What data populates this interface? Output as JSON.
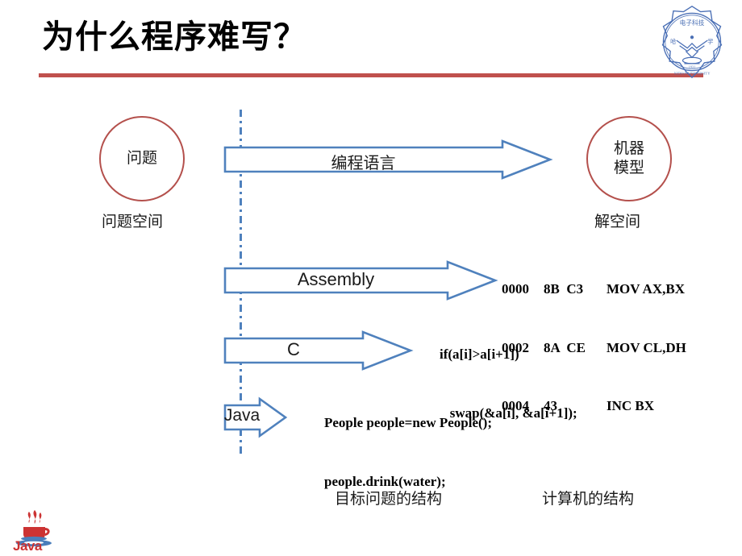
{
  "slide": {
    "title": "为什么程序难写？",
    "accent_color": "#C0504D",
    "arrow_color": "#4F81BD",
    "circle_color": "#B4504C"
  },
  "logo": {
    "name": "xidian-university-seal",
    "latin_text": "XIDIAN UNIVERSITY",
    "year": "1931"
  },
  "diagram": {
    "left_node": {
      "text": "问题",
      "caption": "问题空间"
    },
    "right_node": {
      "line1": "机器",
      "line2": "模型",
      "caption": "解空间"
    },
    "arrows": [
      {
        "label": "编程语言"
      },
      {
        "label": "Assembly"
      },
      {
        "label": "C"
      },
      {
        "label": "Java"
      }
    ],
    "assembly_code": [
      {
        "addr": "0000",
        "bytes": "8B  C3",
        "mnemonic": "MOV AX,BX"
      },
      {
        "addr": "0002",
        "bytes": "8A  CE",
        "mnemonic": "MOV CL,DH"
      },
      {
        "addr": "0004",
        "bytes": "43",
        "mnemonic": "INC BX"
      }
    ],
    "c_code": {
      "line1": "if(a[i]>a[i+1])",
      "line2": "   swap(&a[i], &a[i+1]);"
    },
    "java_code": {
      "line1": "People people=new People();",
      "line2": "people.drink(water);"
    },
    "bottom_captions": {
      "left": "目标问题的结构",
      "right": "计算机的结构"
    }
  },
  "footer": {
    "java_label": "Java"
  }
}
